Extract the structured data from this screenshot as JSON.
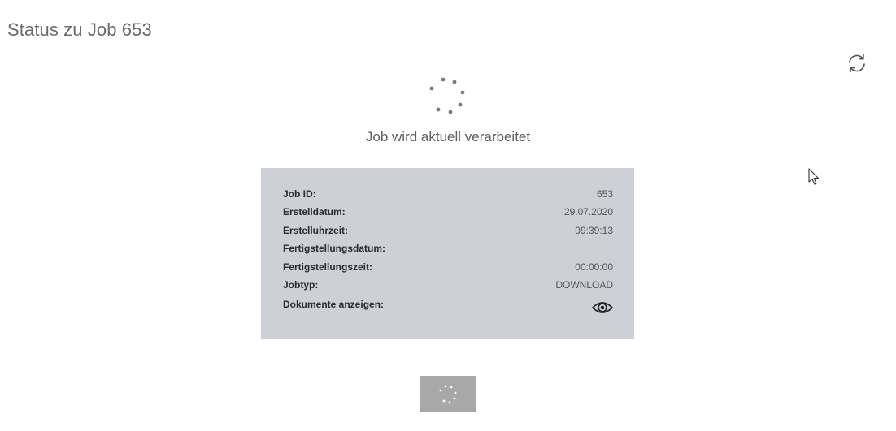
{
  "page": {
    "title": "Status zu Job 653"
  },
  "status": {
    "message": "Job wird aktuell verarbeitet"
  },
  "icons": {
    "refresh": "refresh-icon",
    "spinner": "loading-spinner-icon",
    "eye": "eye-icon",
    "cursor": "mouse-pointer-icon"
  },
  "job_details": {
    "job_id": {
      "label": "Job ID:",
      "value": "653"
    },
    "created_date": {
      "label": "Erstelldatum:",
      "value": "29.07.2020"
    },
    "created_time": {
      "label": "Erstelluhrzeit:",
      "value": "09:39:13"
    },
    "completion_date": {
      "label": "Fertigstellungsdatum:",
      "value": ""
    },
    "completion_time": {
      "label": "Fertigstellungszeit:",
      "value": "00:00:00"
    },
    "job_type": {
      "label": "Jobtyp:",
      "value": "DOWNLOAD"
    },
    "show_documents": {
      "label": "Dokumente anzeigen:"
    }
  },
  "colors": {
    "panel_background": "#cdd0d4",
    "button_background": "#a8a8a8",
    "spinner_dots": "#7a7a7a"
  }
}
